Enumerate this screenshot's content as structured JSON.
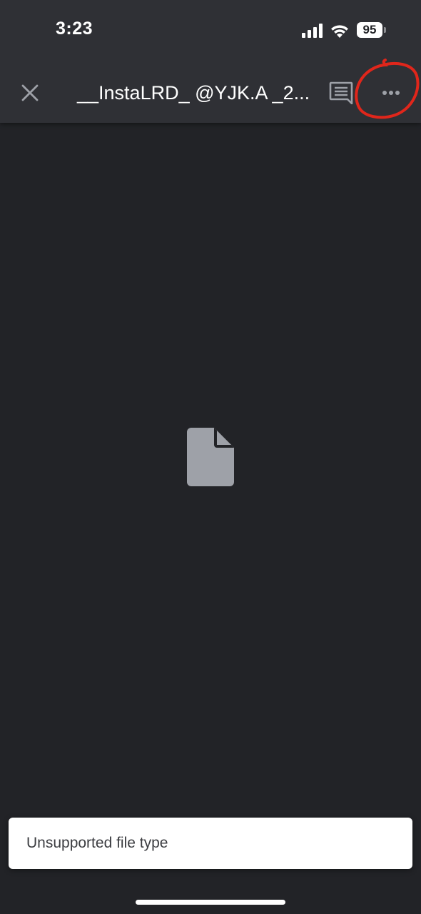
{
  "status_bar": {
    "time": "3:23",
    "battery_level": "95",
    "icons": [
      "signal-icon",
      "wifi-icon",
      "battery-icon"
    ]
  },
  "app_bar": {
    "title": "__InstaLRD_ @YJK.A _2...",
    "icons": [
      "close-icon",
      "comments-icon",
      "more-options-icon"
    ]
  },
  "viewer": {
    "placeholder_icon": "file-icon"
  },
  "toast": {
    "message": "Unsupported file type"
  },
  "colors": {
    "app_bar_bg": "#2f3035",
    "content_bg": "#222327",
    "icon_grey": "#9ea1a8",
    "annotation_red": "#e0261b",
    "toast_bg": "#ffffff"
  }
}
